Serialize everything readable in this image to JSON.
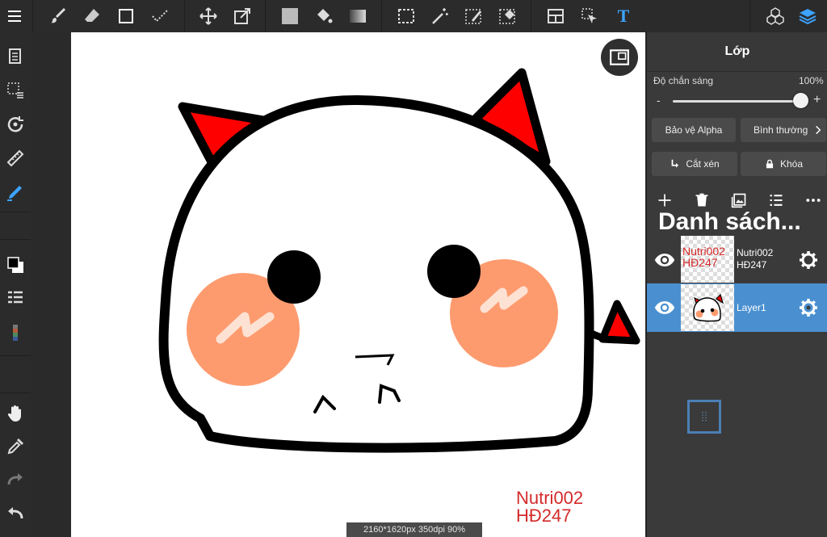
{
  "toolbar": {
    "items": [
      {
        "id": "menu",
        "icon": "menu-icon"
      },
      {
        "id": "brush",
        "icon": "brush-icon"
      },
      {
        "id": "eraser",
        "icon": "eraser-icon"
      },
      {
        "id": "shape",
        "icon": "rectangle-shape-icon"
      },
      {
        "id": "line",
        "icon": "dotted-line-icon"
      },
      {
        "id": "move",
        "icon": "move-icon"
      },
      {
        "id": "transform",
        "icon": "transform-icon"
      },
      {
        "id": "fill-color",
        "icon": "fill-square-icon"
      },
      {
        "id": "bucket",
        "icon": "paint-bucket-icon"
      },
      {
        "id": "gradient",
        "icon": "gradient-icon"
      },
      {
        "id": "select-rect",
        "icon": "rectangle-select-icon"
      },
      {
        "id": "magic-wand",
        "icon": "magic-wand-icon"
      },
      {
        "id": "select-pen",
        "icon": "select-pen-icon"
      },
      {
        "id": "select-eraser",
        "icon": "select-eraser-icon"
      },
      {
        "id": "frame",
        "icon": "frame-divider-icon"
      },
      {
        "id": "operation",
        "icon": "operation-cursor-icon"
      },
      {
        "id": "text",
        "icon": "text-icon",
        "label": "T"
      },
      {
        "id": "3d",
        "icon": "3d-cubes-icon"
      },
      {
        "id": "layers",
        "icon": "layers-icon"
      }
    ]
  },
  "left_tools": [
    {
      "id": "pages",
      "icon": "pages-icon"
    },
    {
      "id": "selection",
      "icon": "selection-list-icon"
    },
    {
      "id": "rotate",
      "icon": "rotate-icon"
    },
    {
      "id": "ruler",
      "icon": "ruler-icon"
    },
    {
      "id": "snap",
      "icon": "snap-pen-icon"
    },
    {
      "id": "color",
      "icon": "color-swatch-icon"
    },
    {
      "id": "layer-list",
      "icon": "layer-list-icon"
    },
    {
      "id": "palette",
      "icon": "palette-icon"
    },
    {
      "id": "hand",
      "icon": "hand-icon"
    },
    {
      "id": "eyedropper",
      "icon": "eyedropper-icon"
    },
    {
      "id": "redo",
      "icon": "redo-icon"
    },
    {
      "id": "undo",
      "icon": "undo-icon"
    }
  ],
  "canvas": {
    "signature": "Nutri002\nHĐ247",
    "status": "2160*1620px 350dpi 90%",
    "colors": {
      "outline": "#000000",
      "horn": "#ff0000",
      "cheek": "#fd9b6f",
      "highlight": "#fde2d3"
    }
  },
  "panel": {
    "title": "Lớp",
    "opacity_label": "Độ chắn sáng",
    "opacity_value": "100%",
    "opacity_level": 1.0,
    "minus": "-",
    "plus": "+",
    "alpha_protect": "Bảo vệ Alpha",
    "blend_mode": "Bình thường",
    "clipping": "Cắt xén",
    "lock": "Khóa",
    "layers_header": "Danh sách...",
    "layers": [
      {
        "name": "Nutri002\nHĐ247",
        "thumb_text": "Nutri002\nHĐ247",
        "selected": false
      },
      {
        "name": "Layer1",
        "selected": true
      }
    ],
    "accent": "#4a90d0"
  }
}
